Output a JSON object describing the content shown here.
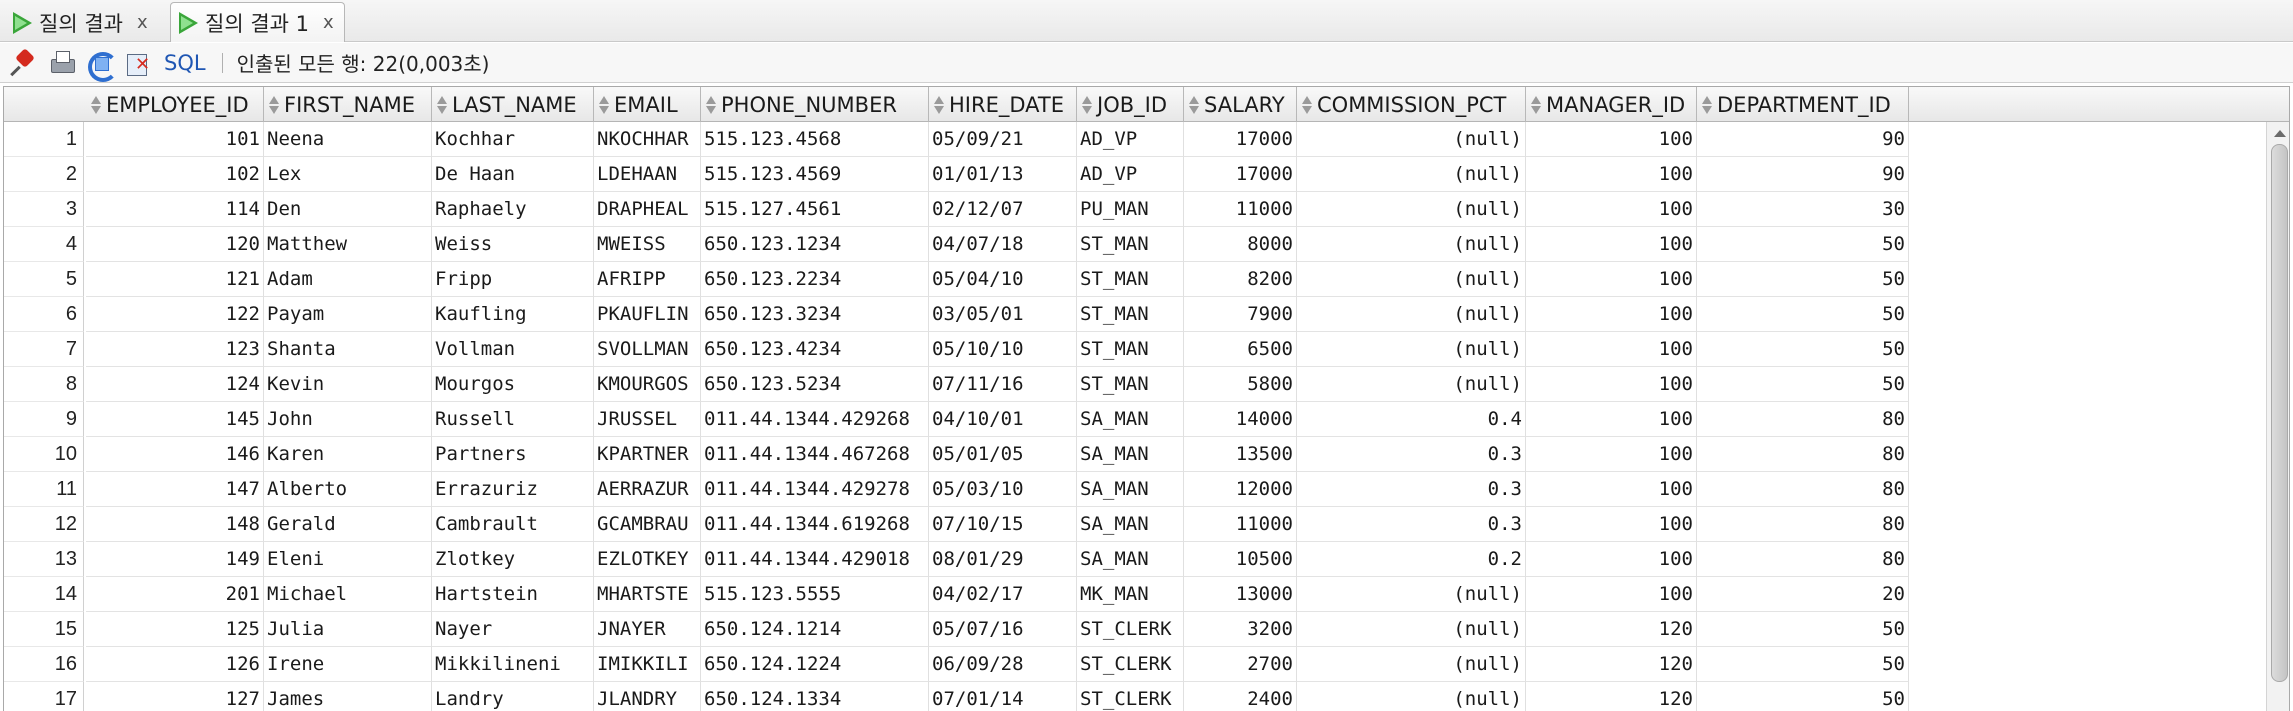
{
  "tabs": [
    {
      "label": "질의 결과",
      "close": "x",
      "active": false
    },
    {
      "label": "질의 결과 1",
      "close": "x",
      "active": true
    }
  ],
  "toolbar": {
    "icons": [
      "pin-icon",
      "print-icon",
      "refresh-icon",
      "cancel-icon"
    ],
    "sql_label": "SQL",
    "separator": "|",
    "status": "인출된 모든 행: 22(0,003초)"
  },
  "grid": {
    "columns": [
      "EMPLOYEE_ID",
      "FIRST_NAME",
      "LAST_NAME",
      "EMAIL",
      "PHONE_NUMBER",
      "HIRE_DATE",
      "JOB_ID",
      "SALARY",
      "COMMISSION_PCT",
      "MANAGER_ID",
      "DEPARTMENT_ID"
    ],
    "rows": [
      [
        "1",
        "101",
        "Neena",
        "Kochhar",
        "NKOCHHAR",
        "515.123.4568",
        "05/09/21",
        "AD_VP",
        "17000",
        "(null)",
        "100",
        "90"
      ],
      [
        "2",
        "102",
        "Lex",
        "De Haan",
        "LDEHAAN",
        "515.123.4569",
        "01/01/13",
        "AD_VP",
        "17000",
        "(null)",
        "100",
        "90"
      ],
      [
        "3",
        "114",
        "Den",
        "Raphaely",
        "DRAPHEAL",
        "515.127.4561",
        "02/12/07",
        "PU_MAN",
        "11000",
        "(null)",
        "100",
        "30"
      ],
      [
        "4",
        "120",
        "Matthew",
        "Weiss",
        "MWEISS",
        "650.123.1234",
        "04/07/18",
        "ST_MAN",
        "8000",
        "(null)",
        "100",
        "50"
      ],
      [
        "5",
        "121",
        "Adam",
        "Fripp",
        "AFRIPP",
        "650.123.2234",
        "05/04/10",
        "ST_MAN",
        "8200",
        "(null)",
        "100",
        "50"
      ],
      [
        "6",
        "122",
        "Payam",
        "Kaufling",
        "PKAUFLIN",
        "650.123.3234",
        "03/05/01",
        "ST_MAN",
        "7900",
        "(null)",
        "100",
        "50"
      ],
      [
        "7",
        "123",
        "Shanta",
        "Vollman",
        "SVOLLMAN",
        "650.123.4234",
        "05/10/10",
        "ST_MAN",
        "6500",
        "(null)",
        "100",
        "50"
      ],
      [
        "8",
        "124",
        "Kevin",
        "Mourgos",
        "KMOURGOS",
        "650.123.5234",
        "07/11/16",
        "ST_MAN",
        "5800",
        "(null)",
        "100",
        "50"
      ],
      [
        "9",
        "145",
        "John",
        "Russell",
        "JRUSSEL",
        "011.44.1344.429268",
        "04/10/01",
        "SA_MAN",
        "14000",
        "0.4",
        "100",
        "80"
      ],
      [
        "10",
        "146",
        "Karen",
        "Partners",
        "KPARTNER",
        "011.44.1344.467268",
        "05/01/05",
        "SA_MAN",
        "13500",
        "0.3",
        "100",
        "80"
      ],
      [
        "11",
        "147",
        "Alberto",
        "Errazuriz",
        "AERRAZUR",
        "011.44.1344.429278",
        "05/03/10",
        "SA_MAN",
        "12000",
        "0.3",
        "100",
        "80"
      ],
      [
        "12",
        "148",
        "Gerald",
        "Cambrault",
        "GCAMBRAU",
        "011.44.1344.619268",
        "07/10/15",
        "SA_MAN",
        "11000",
        "0.3",
        "100",
        "80"
      ],
      [
        "13",
        "149",
        "Eleni",
        "Zlotkey",
        "EZLOTKEY",
        "011.44.1344.429018",
        "08/01/29",
        "SA_MAN",
        "10500",
        "0.2",
        "100",
        "80"
      ],
      [
        "14",
        "201",
        "Michael",
        "Hartstein",
        "MHARTSTE",
        "515.123.5555",
        "04/02/17",
        "MK_MAN",
        "13000",
        "(null)",
        "100",
        "20"
      ],
      [
        "15",
        "125",
        "Julia",
        "Nayer",
        "JNAYER",
        "650.124.1214",
        "05/07/16",
        "ST_CLERK",
        "3200",
        "(null)",
        "120",
        "50"
      ],
      [
        "16",
        "126",
        "Irene",
        "Mikkilineni",
        "IMIKKILI",
        "650.124.1224",
        "06/09/28",
        "ST_CLERK",
        "2700",
        "(null)",
        "120",
        "50"
      ],
      [
        "17",
        "127",
        "James",
        "Landry",
        "JLANDRY",
        "650.124.1334",
        "07/01/14",
        "ST_CLERK",
        "2400",
        "(null)",
        "120",
        "50"
      ]
    ]
  }
}
